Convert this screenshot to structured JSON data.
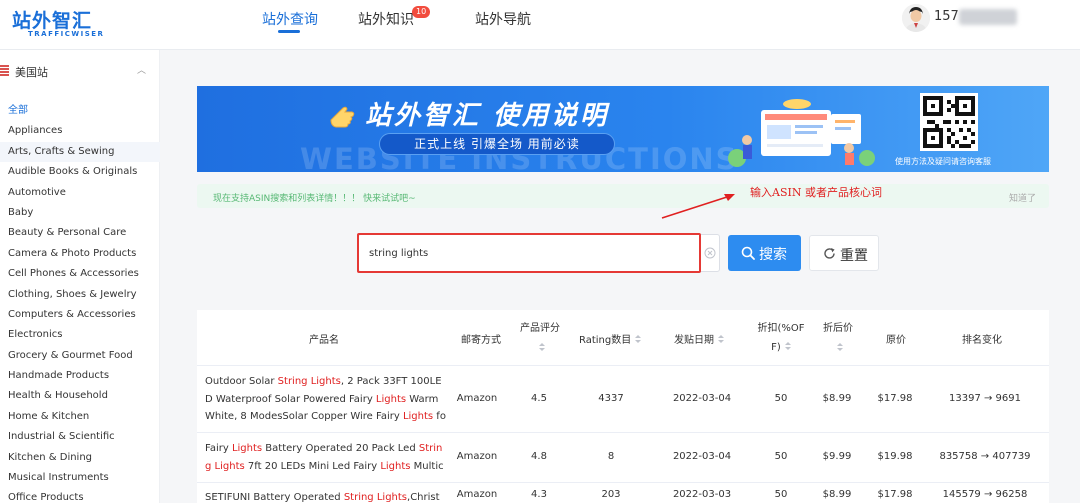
{
  "header": {
    "logo_text": "站外智汇",
    "logo_sub": "TRAFFICWISER",
    "nav": [
      {
        "label": "站外查询",
        "active": true
      },
      {
        "label": "站外知识",
        "badge": "10"
      },
      {
        "label": "站外导航"
      }
    ],
    "user_phone_visible": "157"
  },
  "sidebar": {
    "site_label": "美国站",
    "categories": [
      "全部",
      "Appliances",
      "Arts, Crafts & Sewing",
      "Audible Books & Originals",
      "Automotive",
      "Baby",
      "Beauty & Personal Care",
      "Camera & Photo Products",
      "Cell Phones & Accessories",
      "Clothing, Shoes & Jewelry",
      "Computers & Accessories",
      "Electronics",
      "Grocery & Gourmet Food",
      "Handmade Products",
      "Health & Household",
      "Home & Kitchen",
      "Industrial & Scientific",
      "Kitchen & Dining",
      "Musical Instruments",
      "Office Products"
    ],
    "active_index": 0,
    "hover_index": 2
  },
  "banner": {
    "title": "站外智汇 使用说明",
    "pill": "正式上线 引爆全场 用前必读",
    "watermark": "WEBSITE INSTRUCTIONS",
    "qr_caption": "使用方法及疑问请咨询客服"
  },
  "notice": {
    "text": "现在支持ASIN搜索和列表详情！！！ 快来试试吧~",
    "close": "知道了"
  },
  "annotation": "输入ASIN 或者产品核心词",
  "search": {
    "value": "string lights",
    "search_label": "搜索",
    "reset_label": "重置"
  },
  "table": {
    "headers": [
      "产品名",
      "邮寄方式",
      "产品评分",
      "Rating数目",
      "发贴日期",
      "折扣(%OF F)",
      "折后价",
      "原价",
      "排名变化"
    ],
    "rows": [
      {
        "name": "Outdoor Solar String Lights, 2 Pack 33FT 100LED Waterproof Solar Powered Fairy Lights Warm White, 8 ModesSolar Copper Wire Fairy Lights for Xmas, P…",
        "shipping": "Amazon",
        "rating": "4.5",
        "rating_count": "4337",
        "date": "2022-03-04",
        "discount": "50",
        "sale_price": "$8.99",
        "orig_price": "$17.98",
        "rank": "13397 → 9691"
      },
      {
        "name": "Fairy Lights Battery Operated 20 Pack Led String Lights 7ft 20 LEDs Mini Led Fairy Lights Multicolor",
        "shipping": "Amazon",
        "rating": "4.8",
        "rating_count": "8",
        "date": "2022-03-04",
        "discount": "50",
        "sale_price": "$9.99",
        "orig_price": "$19.98",
        "rank": "835758 → 407739"
      },
      {
        "name": "SETIFUNI Battery Operated String Lights,Christmas",
        "shipping": "Amazon",
        "rating": "4.3",
        "rating_count": "203",
        "date": "2022-03-03",
        "discount": "50",
        "sale_price": "$8.99",
        "orig_price": "$17.98",
        "rank": "145579 → 96258"
      }
    ]
  },
  "colors": {
    "accent": "#1a6fd8",
    "button": "#2d8cf0",
    "highlight": "#e02020",
    "notice_text": "#57b874"
  }
}
